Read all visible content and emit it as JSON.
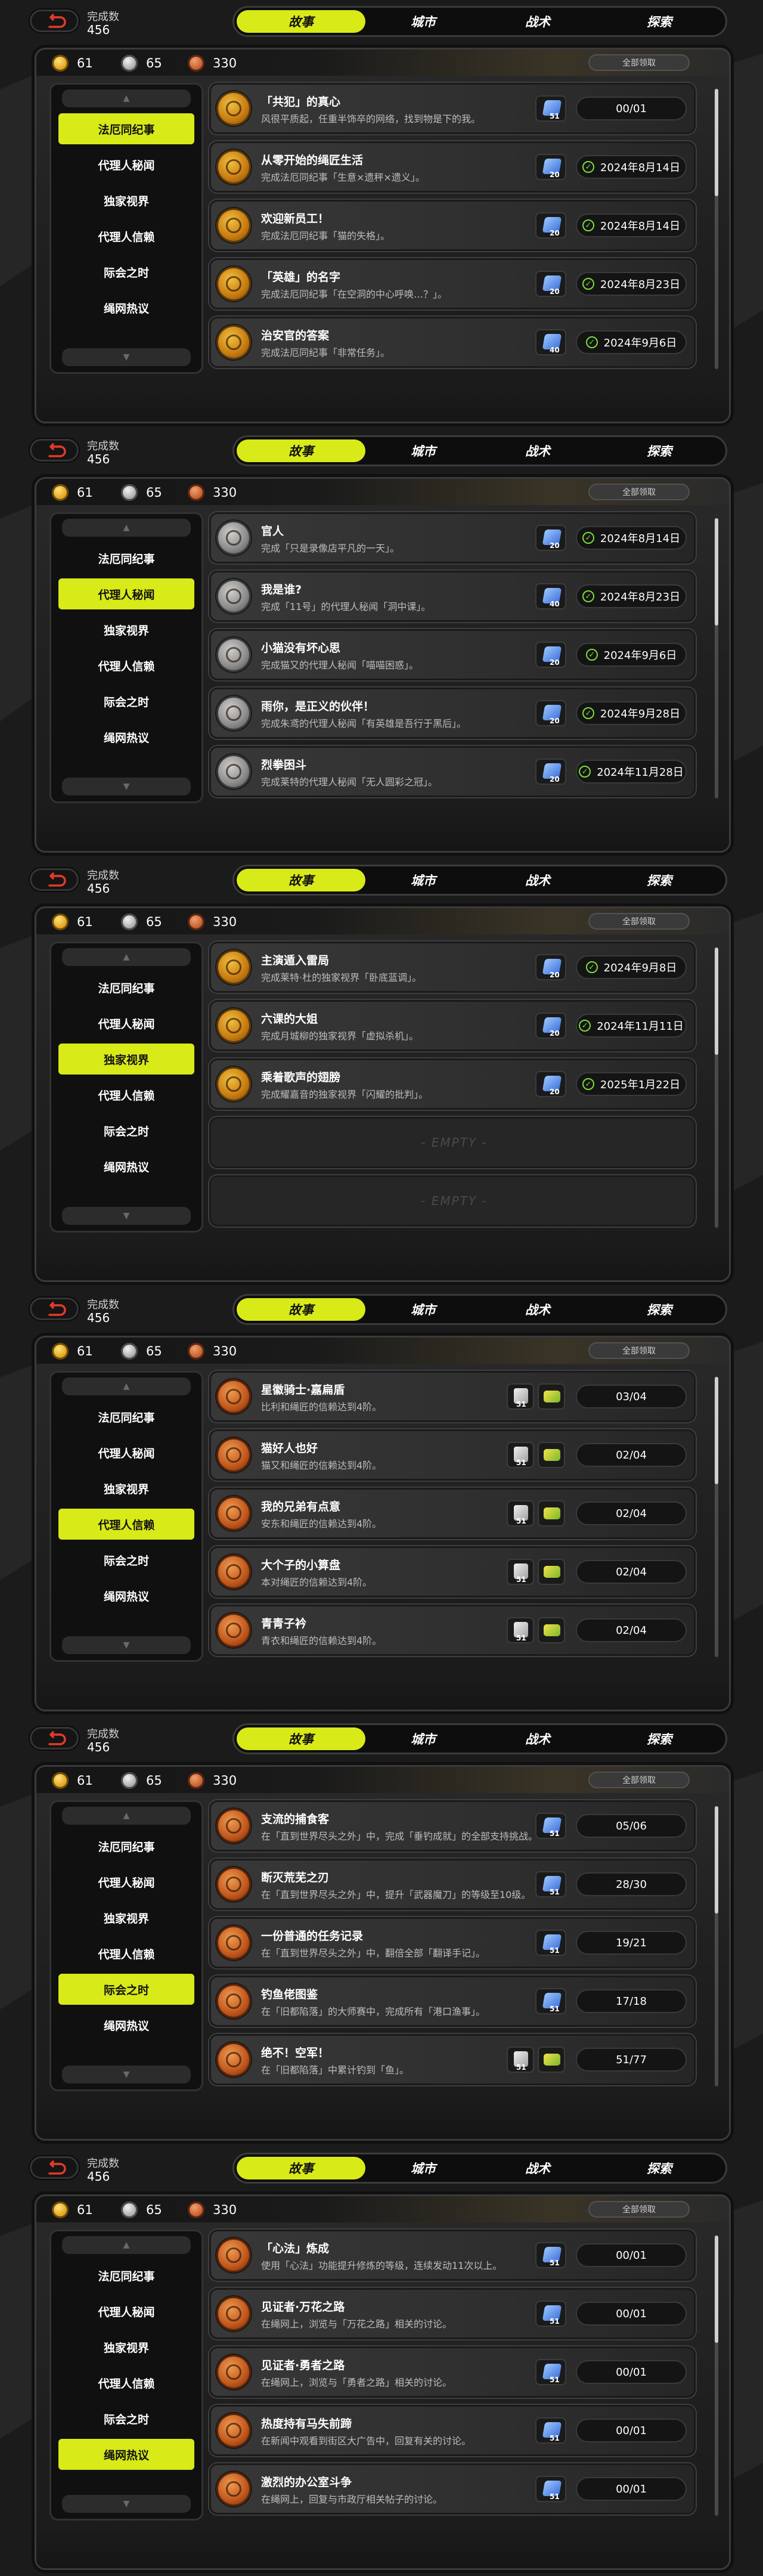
{
  "colors": {
    "accent": "#d8ea18",
    "background": "#1b1b1b",
    "check": "#7ddc3a"
  },
  "common": {
    "completion_label": "完成数",
    "completion_value": "456",
    "nav_tabs": [
      "故事",
      "城市",
      "战术",
      "探索"
    ],
    "currency": {
      "gold": "61",
      "silver": "65",
      "bronze": "330"
    },
    "claim_all": "全部领取",
    "sidebar_items": [
      "法厄同纪事",
      "代理人秘闻",
      "独家视界",
      "代理人信赖",
      "际会之时",
      "绳网热议"
    ],
    "empty_label": "- EMPTY -"
  },
  "panels": [
    {
      "active_nav": 0,
      "active_side": 0,
      "rows": [
        {
          "title": "「共犯」的真心",
          "desc": "风很平质起，任重半饰卒的网络，找到物是下的我。",
          "reward": "51",
          "status": "00/01",
          "done": false
        },
        {
          "title": "从零开始的绳匠生活",
          "desc": "完成法厄同纪事「生意×遗秤×遗义」。",
          "reward": "20",
          "status": "2024年8月14日",
          "done": true
        },
        {
          "title": "欢迎新员工！",
          "desc": "完成法厄同纪事「猫的失格」。",
          "reward": "20",
          "status": "2024年8月14日",
          "done": true
        },
        {
          "title": "「英雄」的名字",
          "desc": "完成法厄同纪事「在空洞的中心呼唤…？」。",
          "reward": "20",
          "status": "2024年8月23日",
          "done": true
        },
        {
          "title": "治安官的答案",
          "desc": "完成法厄同纪事「非常任务」。",
          "reward": "40",
          "status": "2024年9月6日",
          "done": true
        }
      ]
    },
    {
      "active_nav": 0,
      "active_side": 1,
      "rows": [
        {
          "title": "官人",
          "desc": "完成「只是录像店平凡的一天」。",
          "reward": "20",
          "status": "2024年8月14日",
          "done": true,
          "icon": "grey"
        },
        {
          "title": "我是谁?",
          "desc": "完成「11号」的代理人秘闻「洞中课」。",
          "reward": "40",
          "status": "2024年8月23日",
          "done": true,
          "icon": "grey"
        },
        {
          "title": "小猫没有坏心思",
          "desc": "完成猫又的代理人秘闻「喵喵困惑」。",
          "reward": "20",
          "status": "2024年9月6日",
          "done": true,
          "icon": "grey"
        },
        {
          "title": "雨你，是正义的伙伴！",
          "desc": "完成朱鸢的代理人秘闻「有英雄是吾行于黑后」。",
          "reward": "20",
          "status": "2024年9月28日",
          "done": true,
          "icon": "grey"
        },
        {
          "title": "烈拳困斗",
          "desc": "完成莱特的代理人秘闻「无人圆彩之冠」。",
          "reward": "20",
          "status": "2024年11月28日",
          "done": true,
          "icon": "grey"
        }
      ]
    },
    {
      "active_nav": 0,
      "active_side": 2,
      "rows": [
        {
          "title": "主演遁入雷局",
          "desc": "完成莱特·杜的独家视界「卧底蓝调」。",
          "reward": "20",
          "status": "2024年9月8日",
          "done": true
        },
        {
          "title": "六课的大姐",
          "desc": "完成月城柳的独家视界「虚拟杀机」。",
          "reward": "20",
          "status": "2024年11月11日",
          "done": true
        },
        {
          "title": "乘着歌声的翅膀",
          "desc": "完成耀嘉音的独家视界「闪耀的批判」。",
          "reward": "20",
          "status": "2025年1月22日",
          "done": true
        }
      ],
      "empty_rows": 2
    },
    {
      "active_nav": 0,
      "active_side": 3,
      "rows": [
        {
          "title": "星徽骑士·嘉扁盾",
          "desc": "比利和绳匠的信赖达到4阶。",
          "reward": "51",
          "status": "03/04",
          "done": false,
          "icon": "orange",
          "double": true
        },
        {
          "title": "猫好人也好",
          "desc": "猫又和绳匠的信赖达到4阶。",
          "reward": "51",
          "status": "02/04",
          "done": false,
          "icon": "orange",
          "double": true
        },
        {
          "title": "我的兄弟有点意",
          "desc": "安东和绳匠的信赖达到4阶。",
          "reward": "51",
          "status": "02/04",
          "done": false,
          "icon": "orange",
          "double": true
        },
        {
          "title": "大个子的小算盘",
          "desc": "本对绳匠的信赖达到4阶。",
          "reward": "51",
          "status": "02/04",
          "done": false,
          "icon": "orange",
          "double": true
        },
        {
          "title": "青青子衿",
          "desc": "青衣和绳匠的信赖达到4阶。",
          "reward": "51",
          "status": "02/04",
          "done": false,
          "icon": "orange",
          "double": true
        }
      ]
    },
    {
      "active_nav": 0,
      "active_side": 4,
      "rows": [
        {
          "title": "支流的捕食客",
          "desc": "在「直到世界尽头之外」中，完成「垂钓成就」的全部支持挑战。",
          "reward": "51",
          "status": "05/06",
          "done": false,
          "icon": "orange"
        },
        {
          "title": "断灭荒芜之刃",
          "desc": "在「直到世界尽头之外」中，提升「武器魔刀」的等级至10级。",
          "reward": "51",
          "status": "28/30",
          "done": false,
          "icon": "orange"
        },
        {
          "title": "一份普通的任务记录",
          "desc": "在「直到世界尽头之外」中，翻倍全部「翻译手记」。",
          "reward": "51",
          "status": "19/21",
          "done": false,
          "icon": "orange"
        },
        {
          "title": "钓鱼佬图鉴",
          "desc": "在「旧都陷落」的大师赛中，完成所有「港口渔事」。",
          "reward": "51",
          "status": "17/18",
          "done": false,
          "icon": "orange"
        },
        {
          "title": "绝不！空军！",
          "desc": "在「旧都陷落」中累计钓到「鱼」。",
          "reward": "51",
          "status": "51/77",
          "done": false,
          "icon": "orange",
          "double": true
        }
      ]
    },
    {
      "active_nav": 0,
      "active_side": 5,
      "rows": [
        {
          "title": "「心法」炼成",
          "desc": "使用「心法」功能提升修炼的等级，连续发动11次以上。",
          "reward": "51",
          "status": "00/01",
          "done": false,
          "icon": "orange"
        },
        {
          "title": "见证者·万花之路",
          "desc": "在绳网上，浏览与「万花之路」相关的讨论。",
          "reward": "51",
          "status": "00/01",
          "done": false,
          "icon": "orange"
        },
        {
          "title": "见证者·勇者之路",
          "desc": "在绳网上，浏览与「勇者之路」相关的讨论。",
          "reward": "51",
          "status": "00/01",
          "done": false,
          "icon": "orange"
        },
        {
          "title": "热度持有马失前蹄",
          "desc": "在新闻中观看到街区大广告中，回复有关的讨论。",
          "reward": "51",
          "status": "00/01",
          "done": false,
          "icon": "orange"
        },
        {
          "title": "激烈的办公室斗争",
          "desc": "在绳网上，回复与市政厅相关帖子的讨论。",
          "reward": "51",
          "status": "00/01",
          "done": false,
          "icon": "orange"
        }
      ]
    }
  ]
}
